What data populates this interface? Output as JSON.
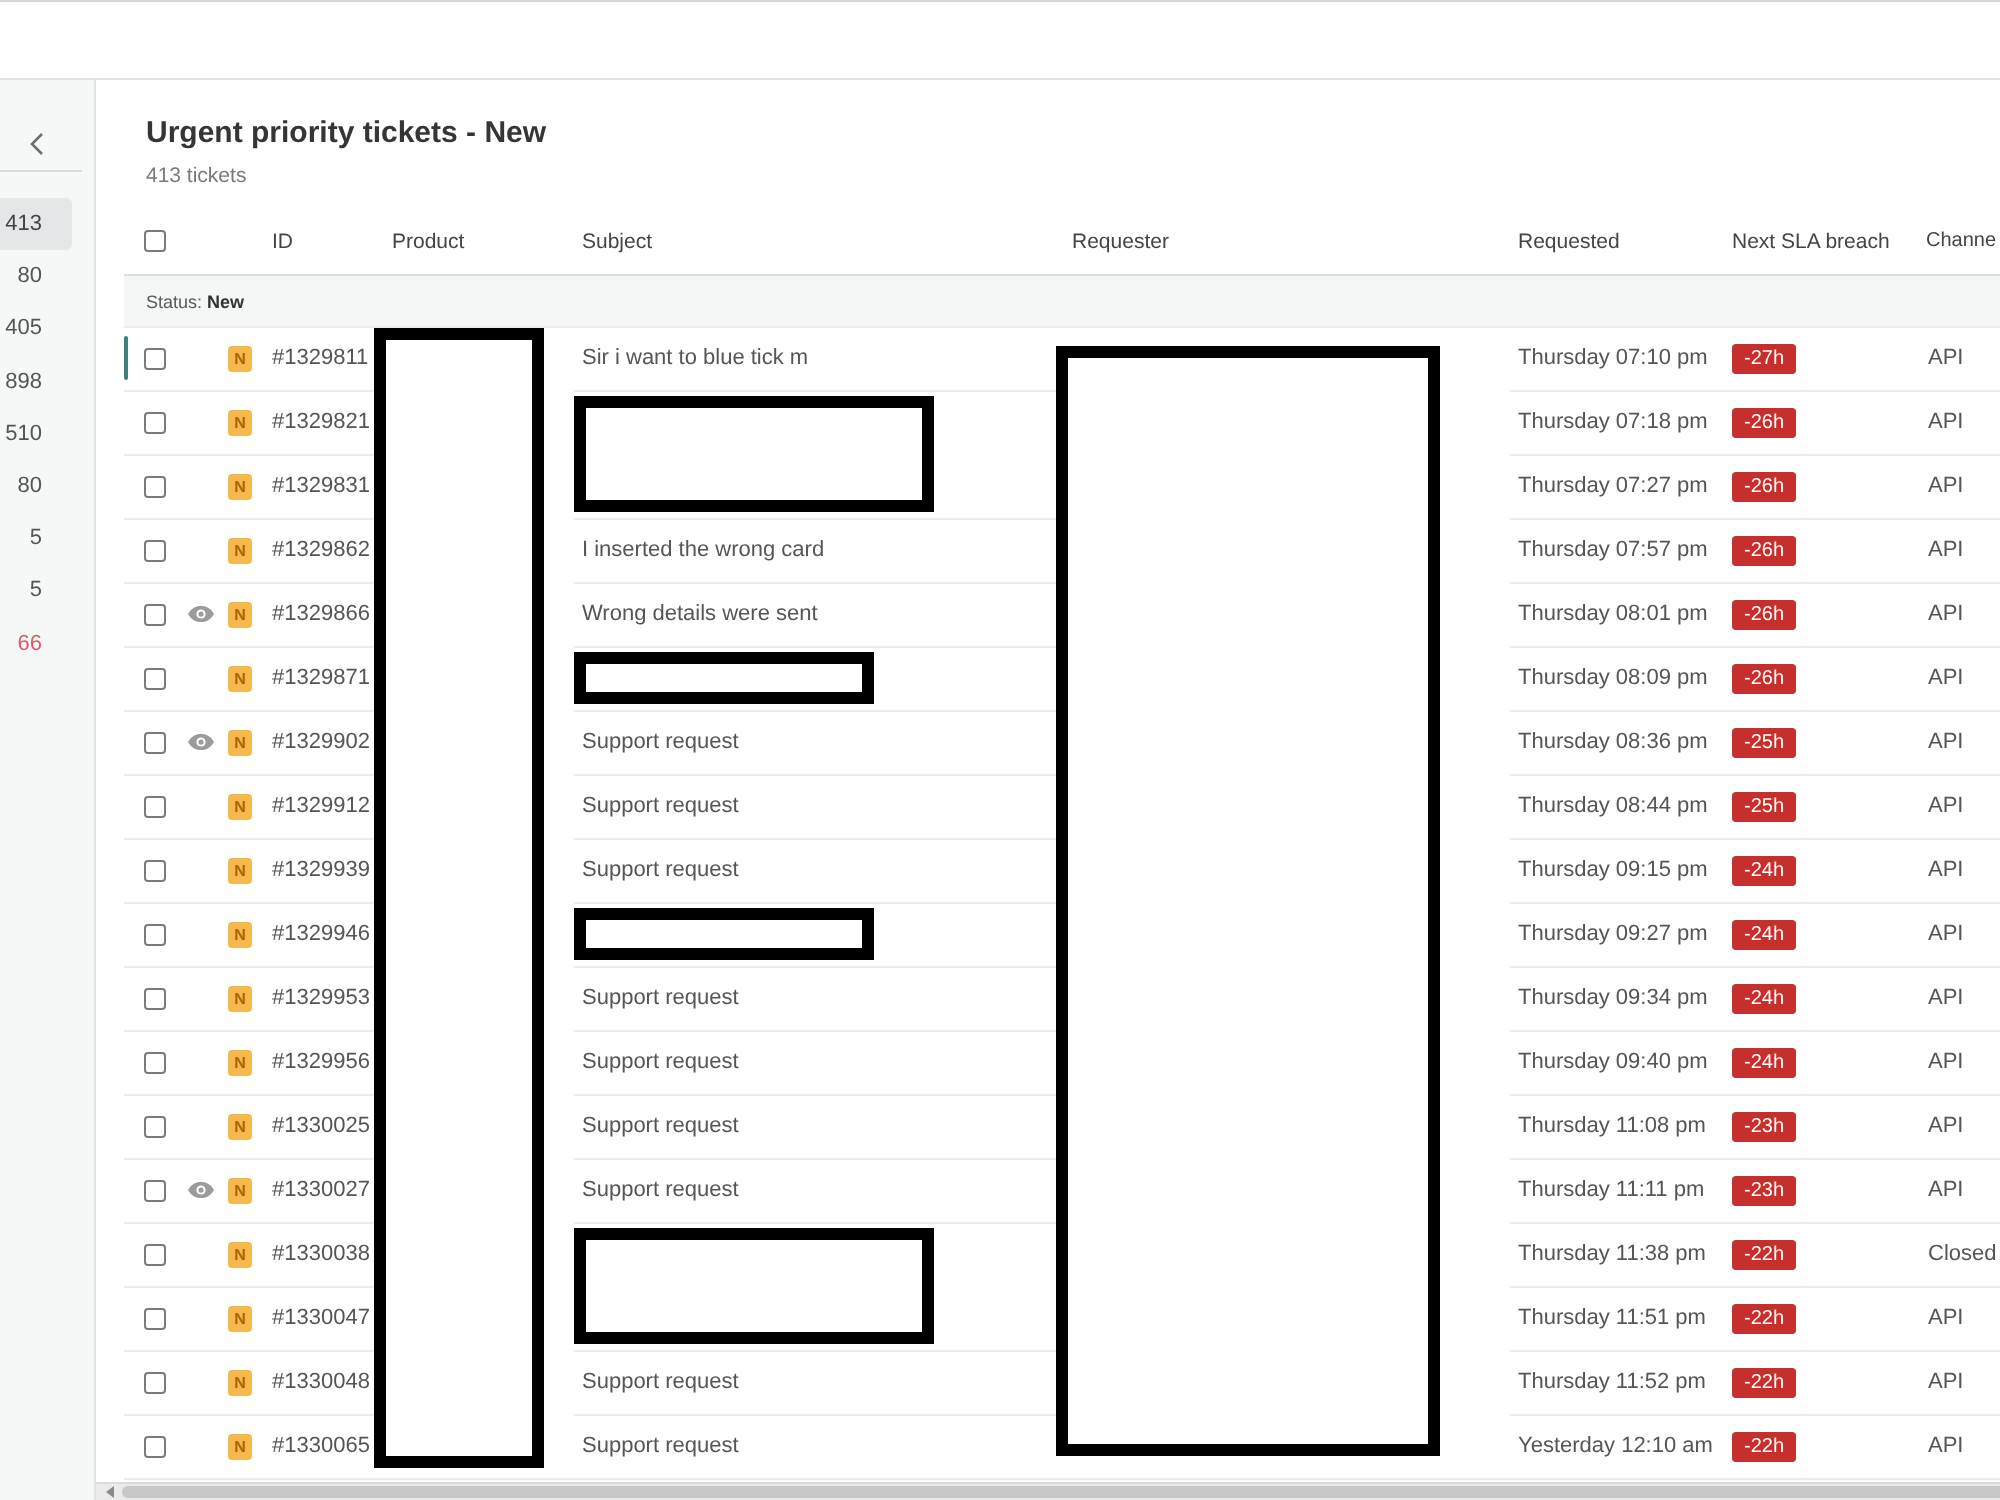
{
  "sidebar": {
    "items": [
      {
        "count": "413",
        "selected": true,
        "color": "#444444"
      },
      {
        "count": "80",
        "selected": false,
        "color": "#555555"
      },
      {
        "count": "405",
        "selected": false,
        "color": "#555555"
      },
      {
        "count": "898",
        "selected": false,
        "color": "#555555"
      },
      {
        "count": "510",
        "selected": false,
        "color": "#555555"
      },
      {
        "count": "80",
        "selected": false,
        "color": "#555555"
      },
      {
        "count": "5",
        "selected": false,
        "color": "#555555"
      },
      {
        "count": "5",
        "selected": false,
        "color": "#555555"
      },
      {
        "count": "66",
        "selected": false,
        "color": "#d95c6a"
      }
    ]
  },
  "view": {
    "title": "Urgent priority tickets - New",
    "subtitle": "413 tickets"
  },
  "table": {
    "select_all": {
      "checked": false
    },
    "columns": [
      {
        "label": "ID",
        "redacted": false
      },
      {
        "label": "Product",
        "redacted": true
      },
      {
        "label": "Subject",
        "redacted": false
      },
      {
        "label": "Requester",
        "redacted": true
      },
      {
        "label": "Requested",
        "redacted": false
      },
      {
        "label": "Next SLA breach",
        "redacted": false
      },
      {
        "label": "Channe",
        "redacted": false
      }
    ],
    "group": "Status: **New**",
    "rows": [
      {
        "id": "#1329811",
        "status": "N",
        "viewing": false,
        "focused": true,
        "checked": false,
        "subject_redacted": false,
        "subject": "Sir i want to blue tick m",
        "requested": "Thursday 07:10 pm",
        "sla": "-27h",
        "channel": "API"
      },
      {
        "id": "#1329821",
        "status": "N",
        "viewing": false,
        "focused": false,
        "checked": false,
        "subject_redacted": true,
        "requested": "Thursday 07:18 pm",
        "sla": "-26h",
        "channel": "API"
      },
      {
        "id": "#1329831",
        "status": "N",
        "viewing": false,
        "focused": false,
        "checked": false,
        "subject_redacted": true,
        "requested": "Thursday 07:27 pm",
        "sla": "-26h",
        "channel": "API"
      },
      {
        "id": "#1329862",
        "status": "N",
        "viewing": false,
        "focused": false,
        "checked": false,
        "subject_redacted": false,
        "subject": "I inserted the wrong card",
        "requested": "Thursday 07:57 pm",
        "sla": "-26h",
        "channel": "API"
      },
      {
        "id": "#1329866",
        "status": "N",
        "viewing": true,
        "focused": false,
        "checked": false,
        "subject_redacted": false,
        "subject": "Wrong details were sent",
        "requested": "Thursday 08:01 pm",
        "sla": "-26h",
        "channel": "API"
      },
      {
        "id": "#1329871",
        "status": "N",
        "viewing": false,
        "focused": false,
        "checked": false,
        "subject_redacted": true,
        "requested": "Thursday 08:09 pm",
        "sla": "-26h",
        "channel": "API"
      },
      {
        "id": "#1329902",
        "status": "N",
        "viewing": true,
        "focused": false,
        "checked": false,
        "subject_redacted": false,
        "subject": "Support request",
        "requested": "Thursday 08:36 pm",
        "sla": "-25h",
        "channel": "API"
      },
      {
        "id": "#1329912",
        "status": "N",
        "viewing": false,
        "focused": false,
        "checked": false,
        "subject_redacted": false,
        "subject": "Support request",
        "requested": "Thursday 08:44 pm",
        "sla": "-25h",
        "channel": "API"
      },
      {
        "id": "#1329939",
        "status": "N",
        "viewing": false,
        "focused": false,
        "checked": false,
        "subject_redacted": false,
        "subject": "Support request",
        "requested": "Thursday 09:15 pm",
        "sla": "-24h",
        "channel": "API"
      },
      {
        "id": "#1329946",
        "status": "N",
        "viewing": false,
        "focused": false,
        "checked": false,
        "subject_redacted": true,
        "requested": "Thursday 09:27 pm",
        "sla": "-24h",
        "channel": "API"
      },
      {
        "id": "#1329953",
        "status": "N",
        "viewing": false,
        "focused": false,
        "checked": false,
        "subject_redacted": false,
        "subject": "Support request",
        "requested": "Thursday 09:34 pm",
        "sla": "-24h",
        "channel": "API"
      },
      {
        "id": "#1329956",
        "status": "N",
        "viewing": false,
        "focused": false,
        "checked": false,
        "subject_redacted": false,
        "subject": "Support request",
        "requested": "Thursday 09:40 pm",
        "sla": "-24h",
        "channel": "API"
      },
      {
        "id": "#1330025",
        "status": "N",
        "viewing": false,
        "focused": false,
        "checked": false,
        "subject_redacted": false,
        "subject": "Support request",
        "requested": "Thursday 11:08 pm",
        "sla": "-23h",
        "channel": "API"
      },
      {
        "id": "#1330027",
        "status": "N",
        "viewing": true,
        "focused": false,
        "checked": false,
        "subject_redacted": false,
        "subject": "Support request",
        "requested": "Thursday 11:11 pm",
        "sla": "-23h",
        "channel": "API"
      },
      {
        "id": "#1330038",
        "status": "N",
        "viewing": false,
        "focused": false,
        "checked": false,
        "subject_redacted": true,
        "requested": "Thursday 11:38 pm",
        "sla": "-22h",
        "channel": "Closed"
      },
      {
        "id": "#1330047",
        "status": "N",
        "viewing": false,
        "focused": false,
        "checked": false,
        "subject_redacted": true,
        "requested": "Thursday 11:51 pm",
        "sla": "-22h",
        "channel": "API"
      },
      {
        "id": "#1330048",
        "status": "N",
        "viewing": false,
        "focused": false,
        "checked": false,
        "subject_redacted": false,
        "subject": "Support request",
        "requested": "Thursday 11:52 pm",
        "sla": "-22h",
        "channel": "API"
      },
      {
        "id": "#1330065",
        "status": "N",
        "viewing": false,
        "focused": false,
        "checked": false,
        "subject_redacted": false,
        "subject": "Support request",
        "requested": "Yesterday 12:10 am",
        "sla": "-22h",
        "channel": "API"
      }
    ]
  }
}
